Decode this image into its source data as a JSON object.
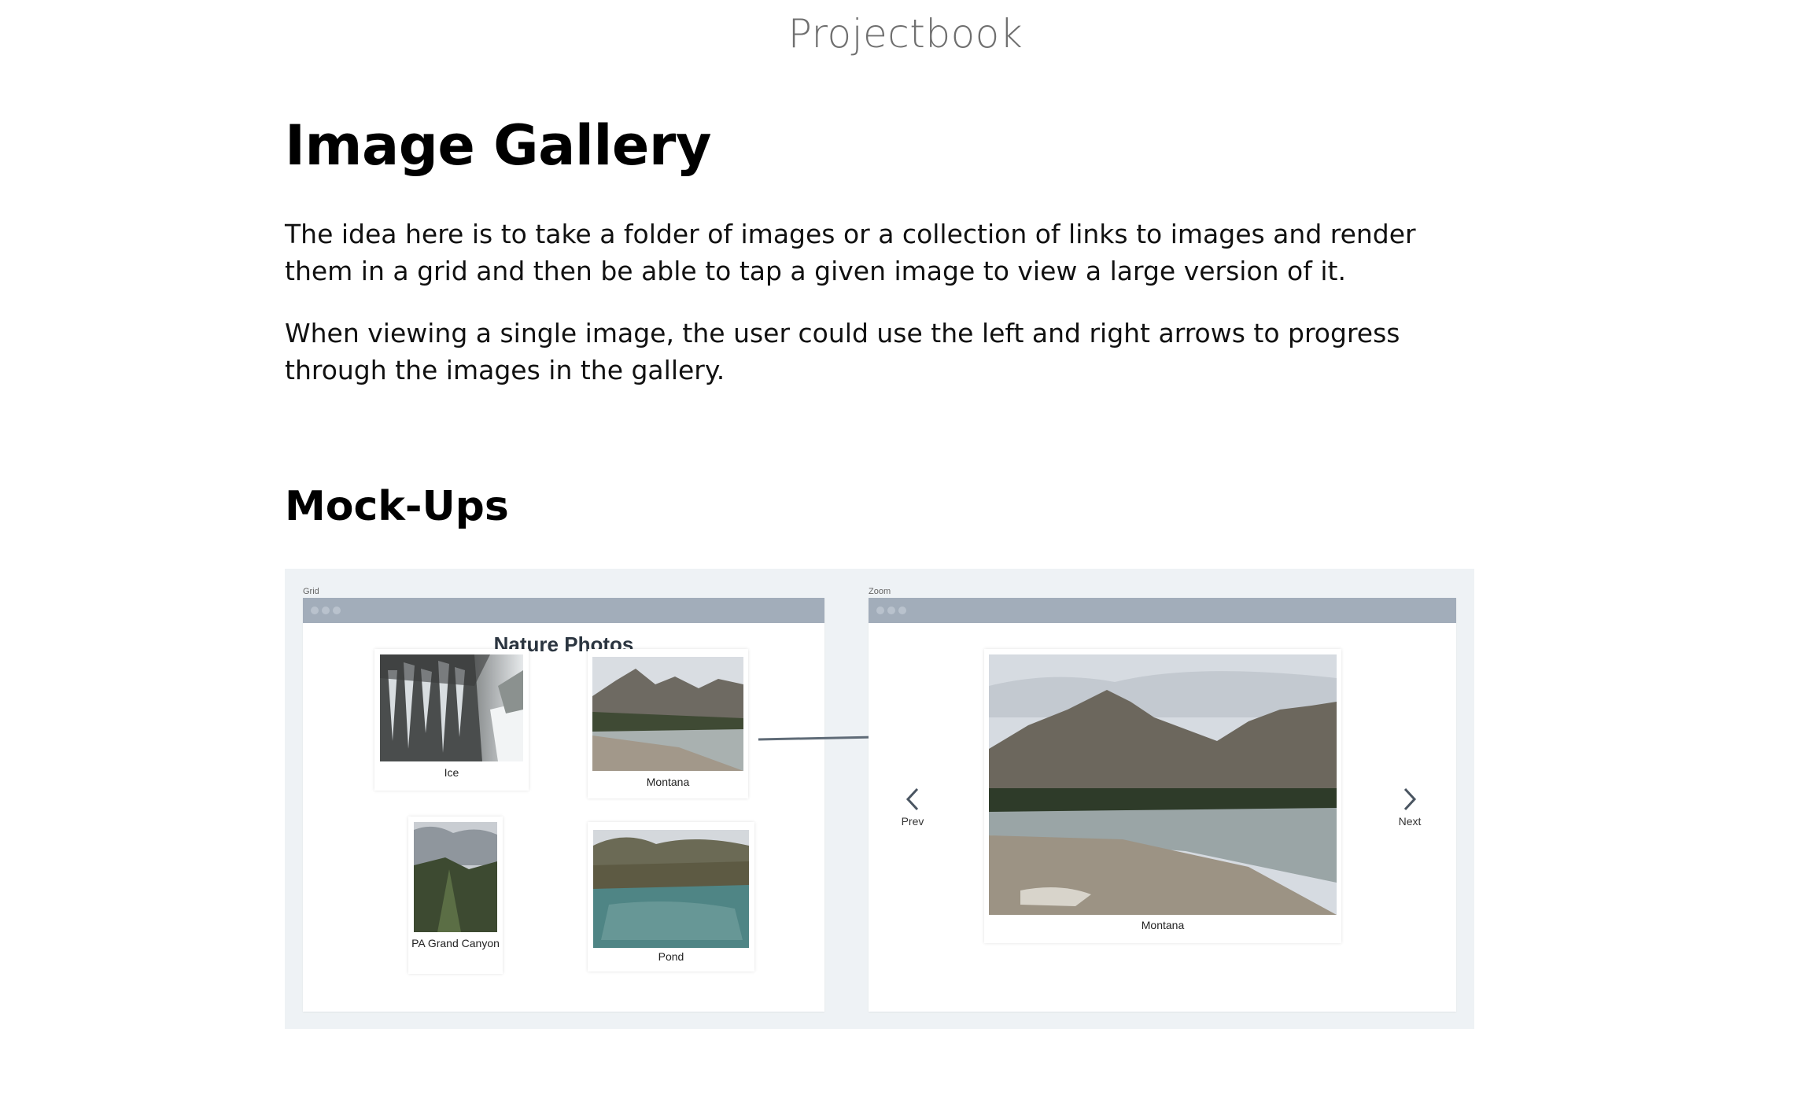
{
  "site": {
    "title": "Projectbook"
  },
  "page": {
    "heading": "Image Gallery",
    "paragraphs": [
      "The idea here is to take a folder of images or a collection of links to images and render them in a grid and then be able to tap a given image to view a large version of it.",
      "When viewing a single image, the user could use the left and right arrows to progress through the images in the gallery."
    ],
    "subheading": "Mock-Ups"
  },
  "mockups": {
    "grid": {
      "frame_label": "Grid",
      "title": "Nature Photos",
      "items": [
        {
          "caption": "Ice"
        },
        {
          "caption": "Montana"
        },
        {
          "caption": "PA Grand Canyon"
        },
        {
          "caption": "Pond"
        }
      ]
    },
    "zoom": {
      "frame_label": "Zoom",
      "caption": "Montana",
      "prev_label": "Prev",
      "next_label": "Next",
      "prev_icon": "chevron-left-icon",
      "next_icon": "chevron-right-icon"
    }
  },
  "colors": {
    "mock_background": "#eef2f5",
    "window_bar": "#a2adba",
    "title_gray": "#6f6f6f"
  }
}
